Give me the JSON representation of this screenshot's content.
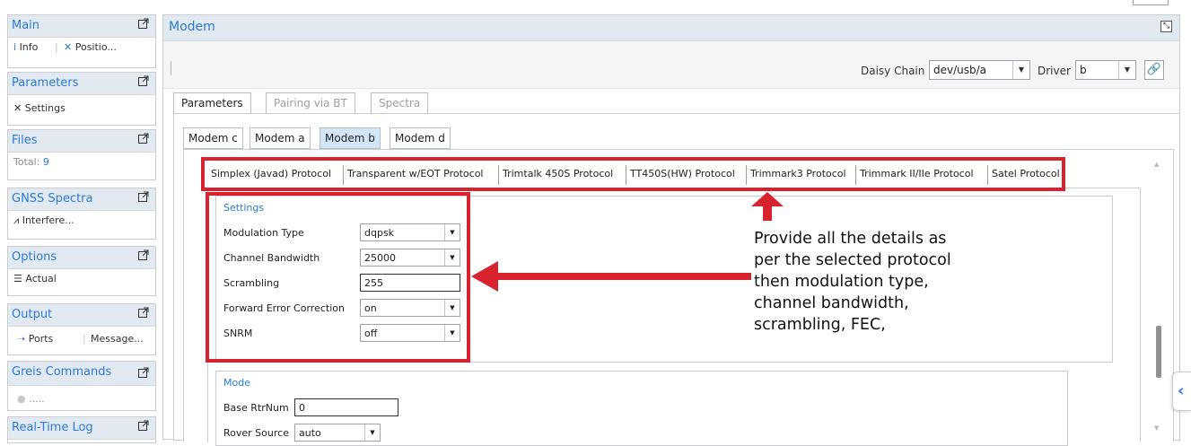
{
  "sidebar": {
    "panels": [
      {
        "title": "Main",
        "items": [
          "Info",
          "Positio..."
        ]
      },
      {
        "title": "Parameters",
        "items": [
          "Settings"
        ]
      },
      {
        "title": "Files",
        "label": "Total:",
        "value": "9"
      },
      {
        "title": "GNSS Spectra",
        "items": [
          "Interfere..."
        ]
      },
      {
        "title": "Options",
        "items": [
          "Actual"
        ]
      },
      {
        "title": "Output",
        "items": [
          "Ports",
          "Message..."
        ]
      },
      {
        "title": "Greis Commands",
        "items": [
          "....."
        ]
      },
      {
        "title": "Real-Time Log"
      }
    ]
  },
  "window": {
    "title": "Modem"
  },
  "toolbar": {
    "daisy_chain_label": "Daisy Chain",
    "daisy_chain_value": "dev/usb/a",
    "driver_label": "Driver",
    "driver_value": "b"
  },
  "top_tabs": [
    "Parameters",
    "Pairing via BT",
    "Spectra"
  ],
  "modem_tabs": [
    "Modem c",
    "Modem a",
    "Modem b",
    "Modem d"
  ],
  "selected_modem": "Modem b",
  "protocol_tabs": [
    "Simplex (Javad) Protocol",
    "Transparent w/EOT Protocol",
    "Trimtalk 450S Protocol",
    "TT450S(HW) Protocol",
    "Trimmark3 Protocol",
    "Trimmark II/IIe Protocol",
    "Satel Protocol"
  ],
  "settings": {
    "title": "Settings",
    "fields": [
      {
        "label": "Modulation Type",
        "value": "dqpsk"
      },
      {
        "label": "Channel Bandwidth",
        "value": "25000"
      },
      {
        "label": "Scrambling",
        "value": "255"
      },
      {
        "label": "Forward Error Correction",
        "value": "on"
      },
      {
        "label": "SNRM",
        "value": "off"
      }
    ]
  },
  "mode": {
    "title": "Mode",
    "fields": [
      {
        "label": "Base RtrNum",
        "value": "0"
      },
      {
        "label": "Rover Source",
        "value": "auto"
      }
    ]
  },
  "annotation": {
    "text_lines": [
      "Provide all the details as",
      "per the selected protocol",
      "then modulation type,",
      "channel bandwidth,",
      "scrambling, FEC,"
    ]
  },
  "colors": {
    "accent": "#2a7bd5",
    "highlight": "#d8232f",
    "panel_header": "#e3e9f1"
  }
}
